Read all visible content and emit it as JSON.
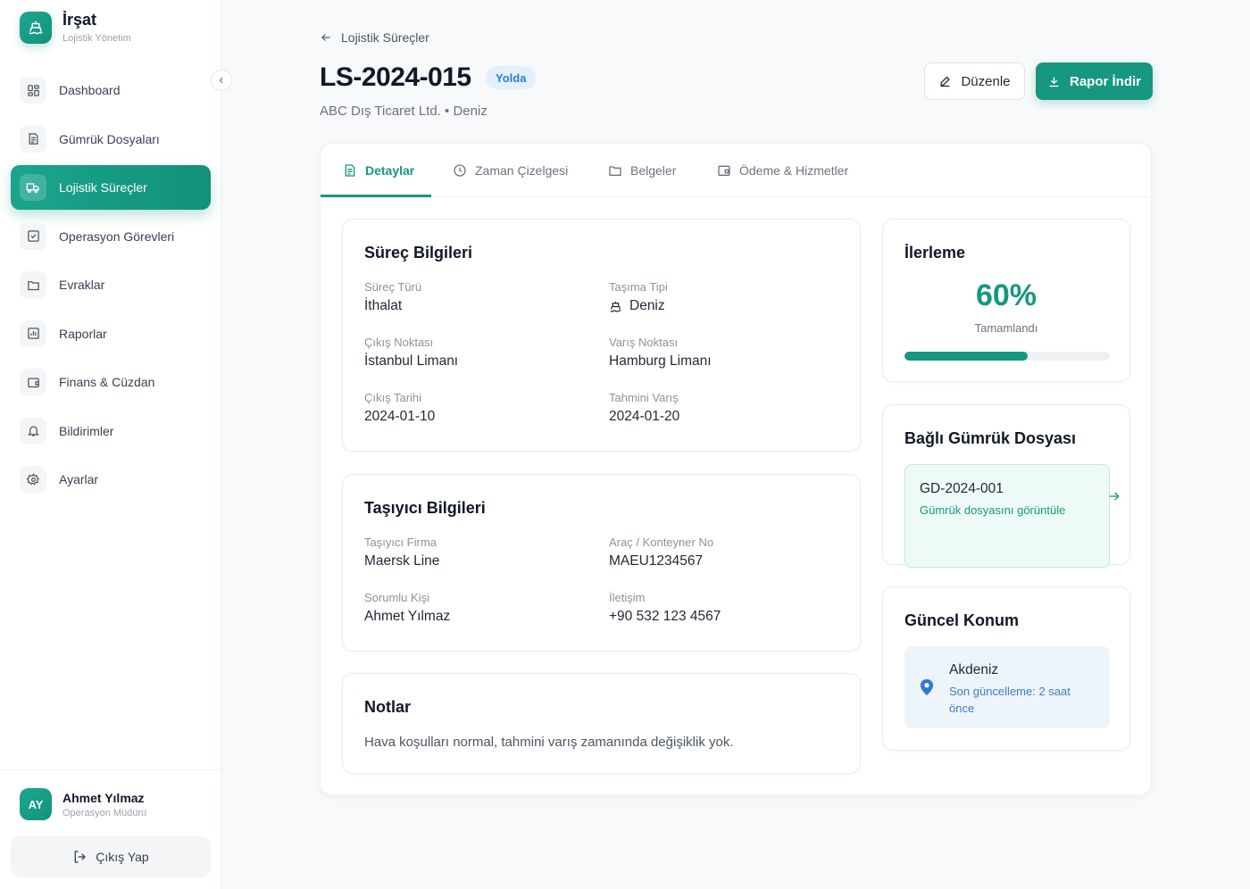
{
  "brand": {
    "title": "İrşat",
    "subtitle": "Lojistik Yönetim"
  },
  "sidebar": {
    "items": [
      {
        "label": "Dashboard",
        "icon": "dashboard-icon"
      },
      {
        "label": "Gümrük Dosyaları",
        "icon": "file-icon"
      },
      {
        "label": "Lojistik Süreçler",
        "icon": "truck-icon",
        "active": true
      },
      {
        "label": "Operasyon Görevleri",
        "icon": "checkbox-icon"
      },
      {
        "label": "Evraklar",
        "icon": "folder-icon"
      },
      {
        "label": "Raporlar",
        "icon": "chart-icon"
      },
      {
        "label": "Finans & Cüzdan",
        "icon": "wallet-icon"
      },
      {
        "label": "Bildirimler",
        "icon": "bell-icon"
      },
      {
        "label": "Ayarlar",
        "icon": "gear-icon"
      }
    ]
  },
  "user": {
    "initials": "AY",
    "name": "Ahmet Yılmaz",
    "role": "Operasyon Müdürü",
    "logout_label": "Çıkış Yap"
  },
  "header": {
    "back_label": "Lojistik Süreçler",
    "title": "LS-2024-015",
    "status": "Yolda",
    "subtitle": "ABC Dış Ticaret Ltd. • Deniz",
    "edit_label": "Düzenle",
    "report_label": "Rapor İndir"
  },
  "tabs": [
    {
      "label": "Detaylar",
      "active": true
    },
    {
      "label": "Zaman Çizelgesi"
    },
    {
      "label": "Belgeler"
    },
    {
      "label": "Ödeme & Hizmetler"
    }
  ],
  "process": {
    "title": "Süreç Bilgileri",
    "fields": [
      {
        "label": "Süreç Türü",
        "value": "İthalat"
      },
      {
        "label": "Taşıma Tipi",
        "value": "Deniz"
      },
      {
        "label": "Çıkış Noktası",
        "value": "İstanbul Limanı"
      },
      {
        "label": "Varış Noktası",
        "value": "Hamburg Limanı"
      },
      {
        "label": "Çıkış Tarihi",
        "value": "2024-01-10"
      },
      {
        "label": "Tahmini Varış",
        "value": "2024-01-20"
      }
    ]
  },
  "carrier": {
    "title": "Taşıyıcı Bilgileri",
    "fields": [
      {
        "label": "Taşıyıcı Firma",
        "value": "Maersk Line"
      },
      {
        "label": "Araç / Konteyner No",
        "value": "MAEU1234567"
      },
      {
        "label": "Sorumlu Kişi",
        "value": "Ahmet Yılmaz"
      },
      {
        "label": "İletişim",
        "value": "+90 532 123 4567"
      }
    ]
  },
  "notes": {
    "title": "Notlar",
    "text": "Hava koşulları normal, tahmini varış zamanında değişiklik yok."
  },
  "progress": {
    "title": "İlerleme",
    "percent_text": "60%",
    "label": "Tamamlandı",
    "fraction": 0.6
  },
  "linked_customs": {
    "title": "Bağlı Gümrük Dosyası",
    "id": "GD-2024-001",
    "link_label": "Gümrük dosyasını görüntüle"
  },
  "location": {
    "title": "Güncel Konum",
    "name": "Akdeniz",
    "updated": "Son güncelleme: 2 saat önce"
  },
  "colors": {
    "accent": "#17977f",
    "badge_bg": "#e3f0fb",
    "badge_text": "#2f7bd0"
  }
}
